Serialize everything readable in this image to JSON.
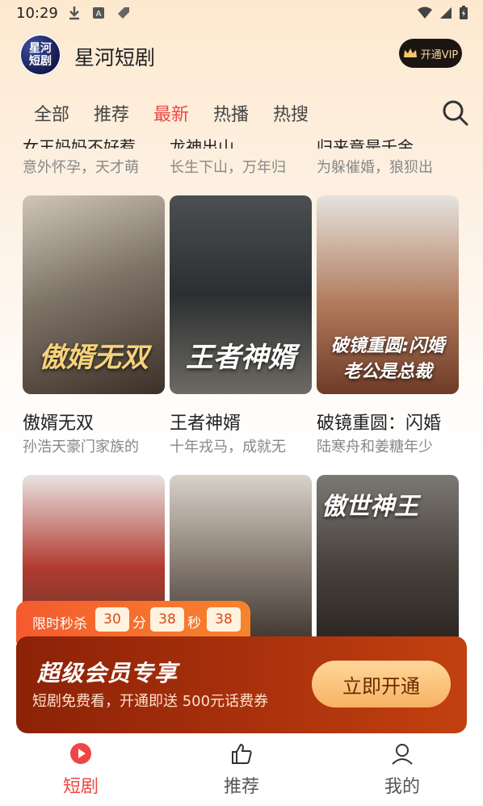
{
  "status_bar": {
    "time": "10:29"
  },
  "header": {
    "app_title": "星河短剧",
    "logo_text": "星河短剧",
    "vip_label": "开通VIP"
  },
  "tabs": [
    {
      "label": "全部"
    },
    {
      "label": "推荐"
    },
    {
      "label": "最新",
      "active": true
    },
    {
      "label": "热播"
    },
    {
      "label": "热搜"
    }
  ],
  "top_row_partial": [
    {
      "title": "女王妈妈不好惹",
      "subtitle": "意外怀孕，天才萌"
    },
    {
      "title": "龙神出山",
      "subtitle": "长生下山，万年归"
    },
    {
      "title": "归来竟是千金",
      "subtitle": "为躲催婚，狼狈出"
    }
  ],
  "dramas_row1": [
    {
      "title": "傲婿无双",
      "subtitle": "孙浩天豪门家族的",
      "poster_text": "傲婿无双"
    },
    {
      "title": "王者神婿",
      "subtitle": "十年戎马，成就无",
      "poster_text": "王者神婿"
    },
    {
      "title": "破镜重圆：闪婚",
      "subtitle": "陆寒舟和姜糖年少",
      "poster_text": "破镜重圆:闪婚老公是总裁"
    }
  ],
  "dramas_row2": [
    {
      "poster_text": ""
    },
    {
      "poster_text": ""
    },
    {
      "poster_text": "傲世神王"
    }
  ],
  "promo": {
    "flash_label": "限时秒杀",
    "timer": {
      "hours": "30",
      "h_unit": "分",
      "minutes": "38",
      "m_unit": "秒",
      "seconds": "38"
    },
    "title": "超级会员专享",
    "subtitle": "短剧免费看，开通即送 500元话费券",
    "cta": "立即开通"
  },
  "bottom_nav": [
    {
      "label": "短剧",
      "icon": "play-icon",
      "active": true
    },
    {
      "label": "推荐",
      "icon": "thumbs-up-icon"
    },
    {
      "label": "我的",
      "icon": "user-icon"
    }
  ],
  "colors": {
    "accent": "#f04545",
    "promo": "#a8300c",
    "cta": "#f8b263"
  }
}
